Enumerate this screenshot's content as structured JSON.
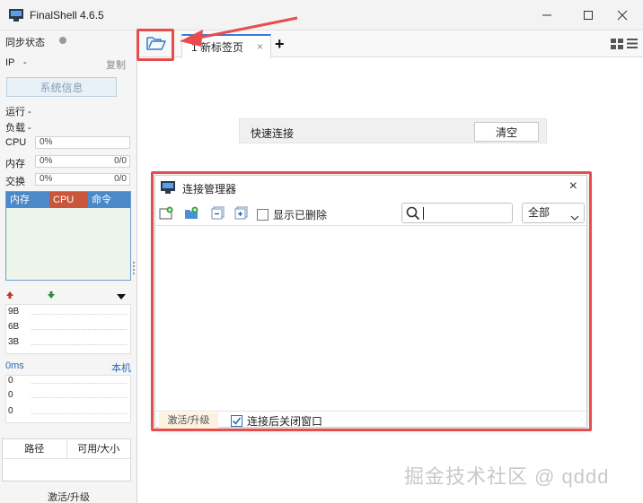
{
  "window": {
    "title": "FinalShell 4.6.5"
  },
  "sidebar": {
    "sync_status": "同步状态",
    "ip_label": "IP",
    "ip_value": "-",
    "copy": "复制",
    "sys_info": "系统信息",
    "run_label": "运行 -",
    "load_label": "负载 -",
    "metrics": [
      {
        "label": "CPU",
        "value": "0%",
        "ratio": ""
      },
      {
        "label": "内存",
        "value": "0%",
        "ratio": "0/0"
      },
      {
        "label": "交换",
        "value": "0%",
        "ratio": "0/0"
      }
    ],
    "proc_headers": [
      "内存",
      "CPU",
      "命令"
    ],
    "net_labels": [
      "9B",
      "6B",
      "3B"
    ],
    "ping_left": "0ms",
    "ping_right": "本机",
    "ping_labels": [
      "0",
      "0",
      "0"
    ],
    "disk_headers": [
      "路径",
      "可用/大小"
    ],
    "activate": "激活/升级"
  },
  "tabs": {
    "items": [
      {
        "label": "1 新标签页"
      }
    ],
    "close_glyph": "×",
    "add_glyph": "+"
  },
  "quick_connect": {
    "label": "快速连接",
    "clear": "清空"
  },
  "dialog": {
    "title": "连接管理器",
    "close_glyph": "×",
    "show_deleted": "显示已删除",
    "search_value": "",
    "filter_value": "全部",
    "activate": "激活/升级",
    "close_after_connect": "连接后关闭窗口",
    "close_after_connect_checked": true
  },
  "watermark": "掘金技术社区 @ qddd",
  "colors": {
    "annotation": "#e84d4d",
    "accent": "#3a7bd5"
  }
}
